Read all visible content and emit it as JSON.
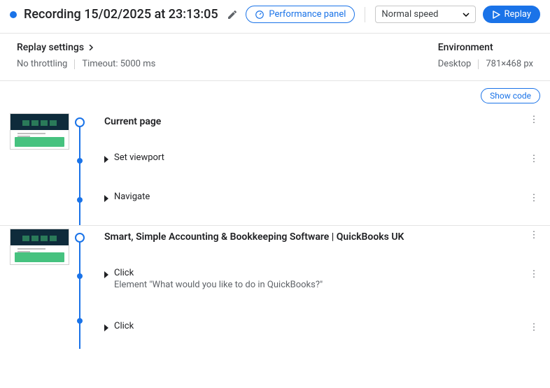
{
  "header": {
    "title": "Recording 15/02/2025 at 23:13:05",
    "performance_panel": "Performance panel",
    "speed_selected": "Normal speed",
    "replay": "Replay"
  },
  "settings": {
    "replay_title": "Replay settings",
    "throttling": "No throttling",
    "timeout": "Timeout: 5000 ms",
    "env_title": "Environment",
    "env_device": "Desktop",
    "env_viewport": "781×468 px"
  },
  "show_code": "Show code",
  "sections": [
    {
      "title": "Current page",
      "steps": [
        {
          "label": "Set viewport"
        },
        {
          "label": "Navigate"
        }
      ]
    },
    {
      "title": "Smart, Simple Accounting & Bookkeeping Software | QuickBooks UK",
      "steps": [
        {
          "label": "Click",
          "sub": "Element \"What would you like to do in QuickBooks?\""
        },
        {
          "label": "Click"
        }
      ]
    }
  ]
}
